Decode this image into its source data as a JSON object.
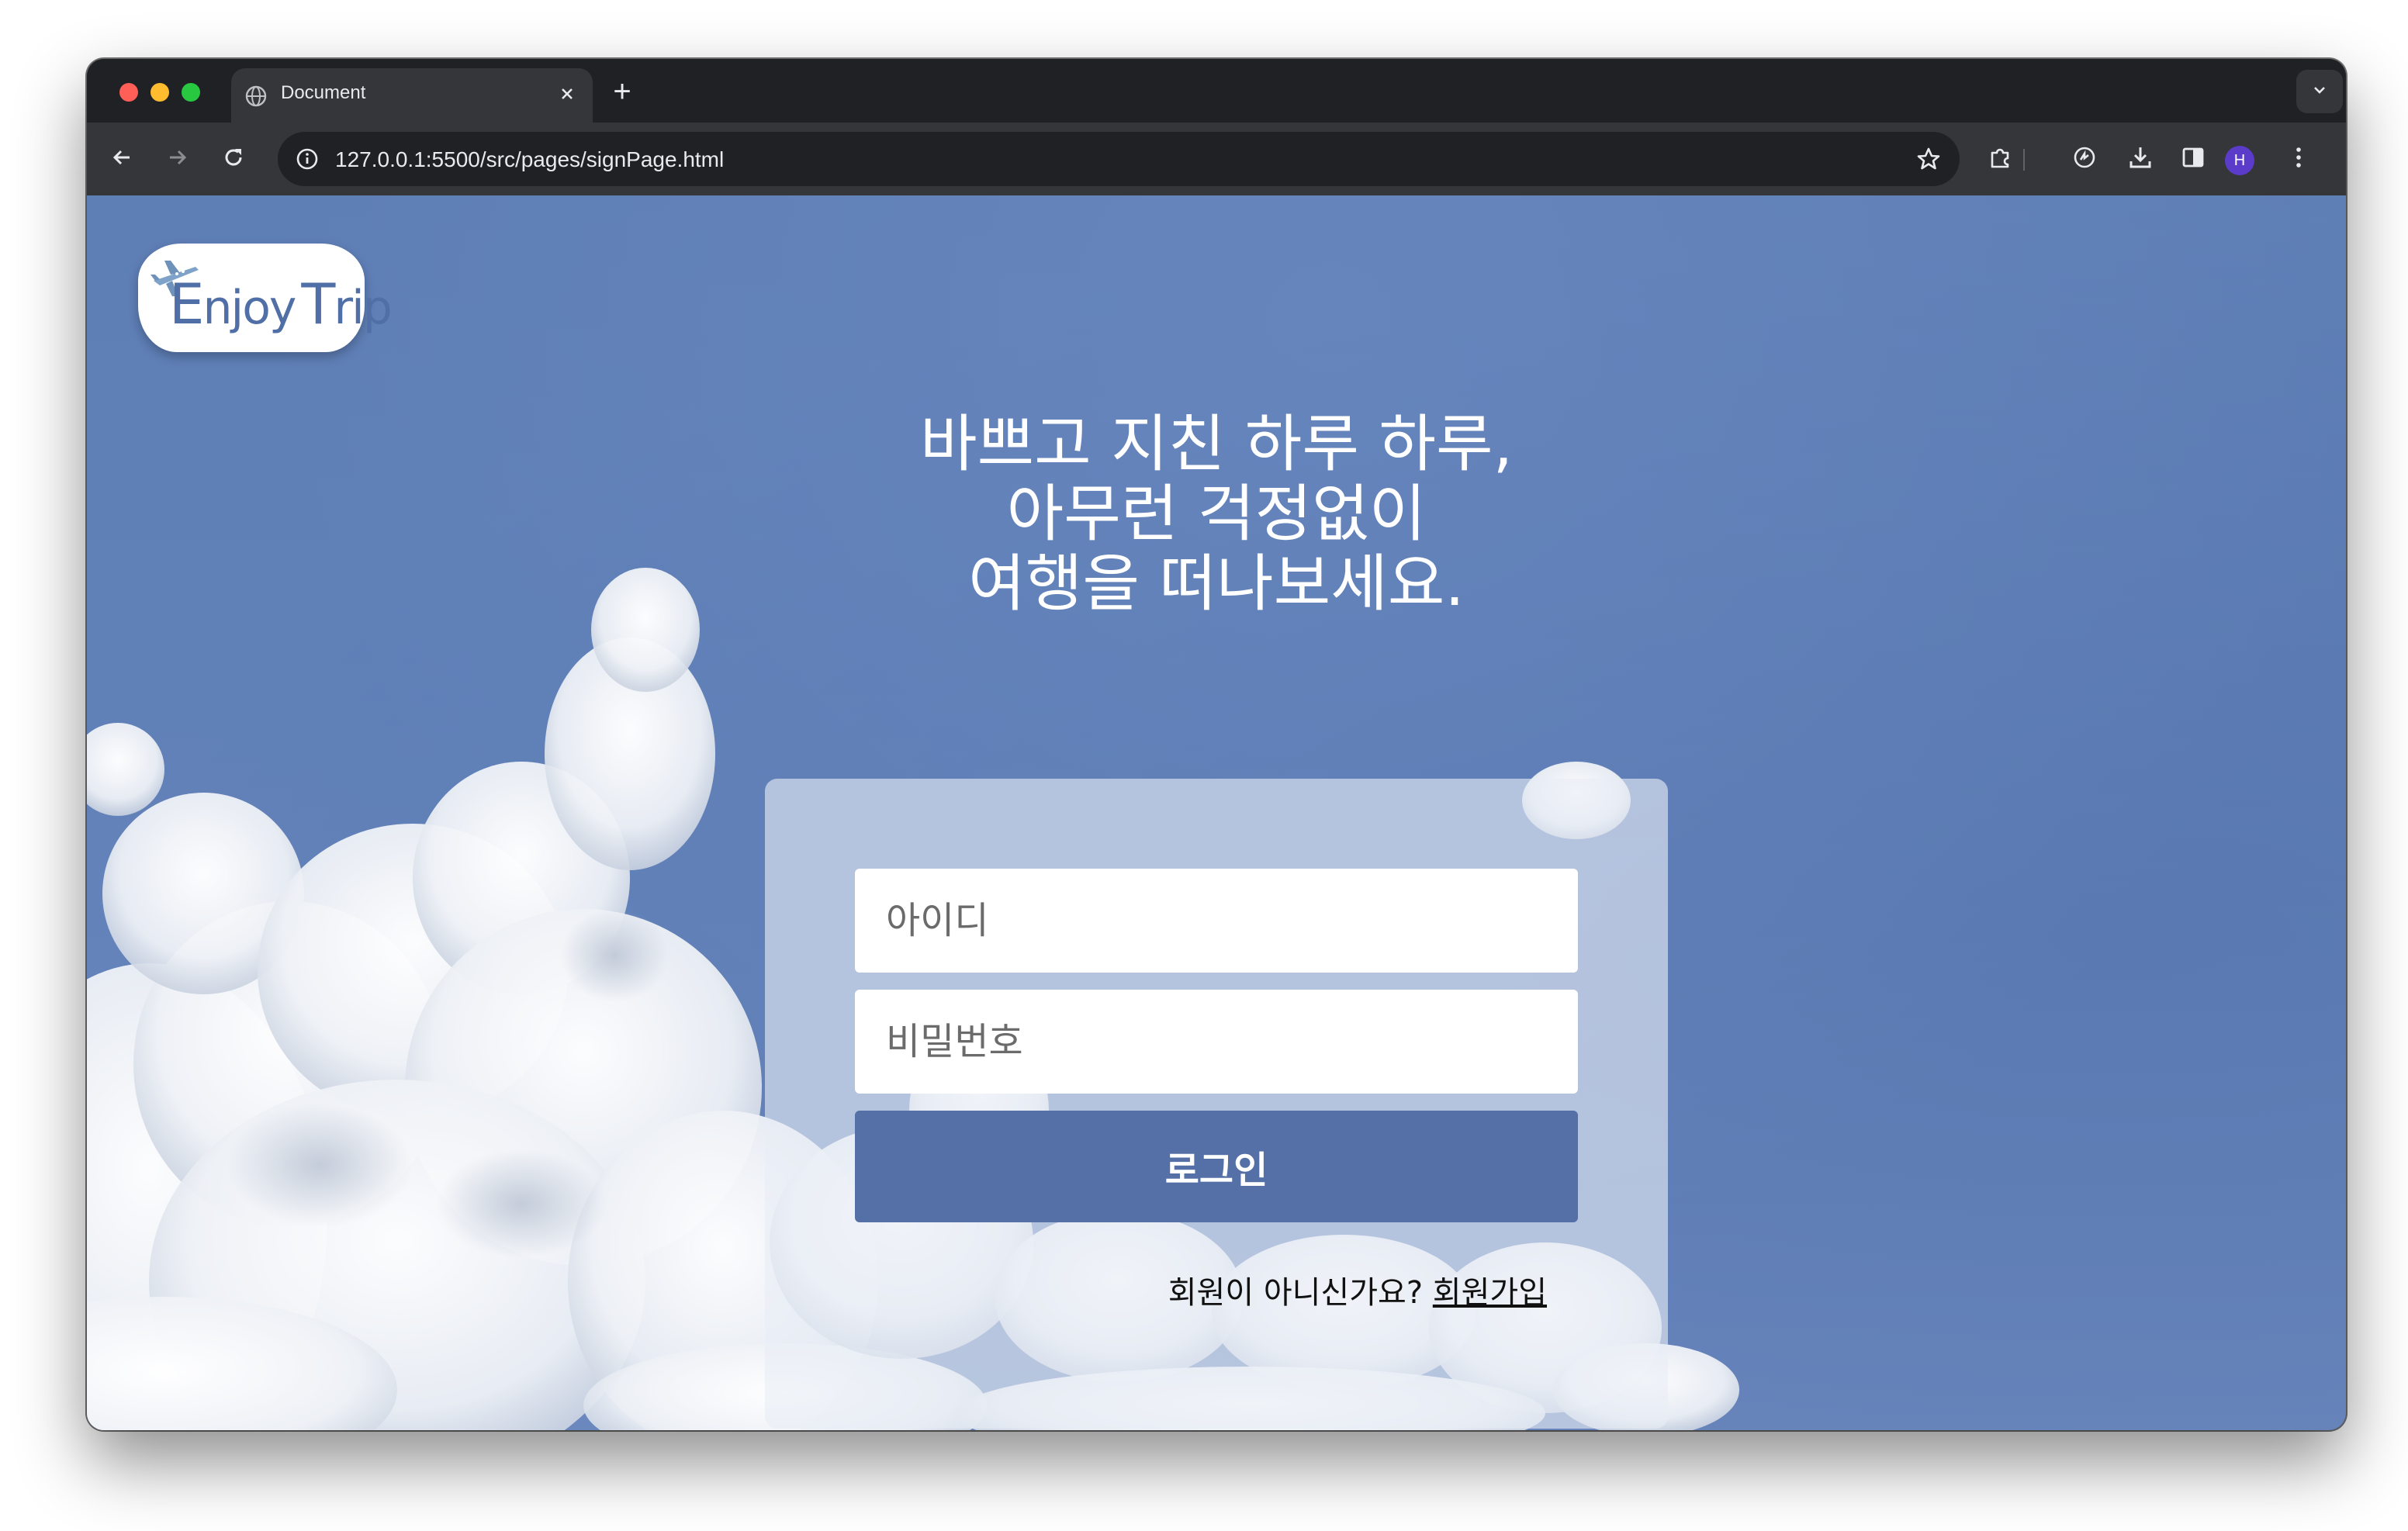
{
  "browser": {
    "tab_title": "Document",
    "tab_close_icon": "close-icon",
    "new_tab_label": "+",
    "url": "127.0.0.1:5500/src/pages/signPage.html",
    "profile_initial": "H",
    "colors": {
      "tab_strip": "#202124",
      "toolbar": "#35363a",
      "omnibox": "#202124",
      "avatar": "#5b3bc9"
    }
  },
  "page": {
    "logo": {
      "text_parts": [
        "E",
        "njoy",
        "T",
        "rip"
      ],
      "icon": "airplane-icon"
    },
    "headline": {
      "lines": [
        "바쁘고 지친 하루 하루,",
        "아무런 걱정없이",
        "여행을 떠나보세요."
      ]
    },
    "login_form": {
      "id_placeholder": "아이디",
      "password_placeholder": "비밀번호",
      "login_button": "로그인",
      "signup_prompt": "회원이 아니신가요?",
      "signup_link": "회원가입"
    },
    "colors": {
      "sky": "#6080b8",
      "button": "#5470a6",
      "logo_text": "#4f6fa6"
    }
  }
}
